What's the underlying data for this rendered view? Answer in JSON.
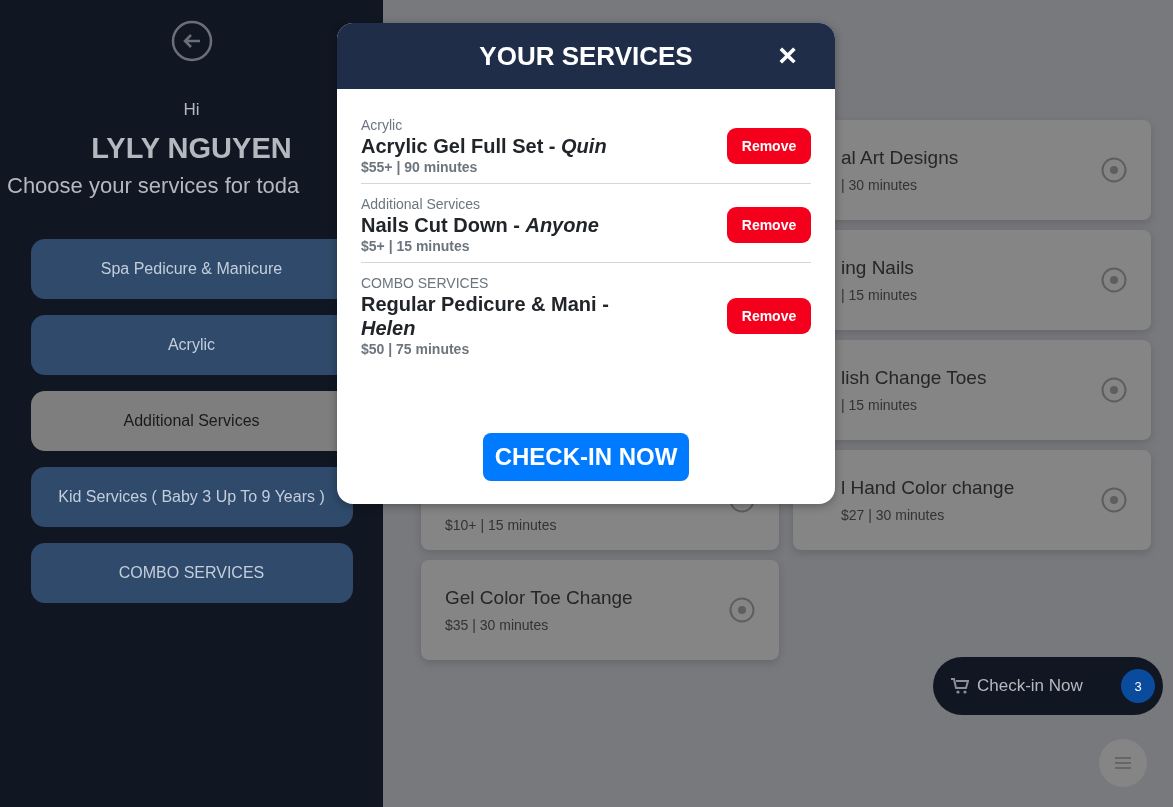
{
  "sidebar": {
    "greeting": "Hi",
    "name": "LYLY NGUYEN",
    "prompt": "Choose your services for toda",
    "categories": [
      {
        "label": "Spa Pedicure & Manicure",
        "selected": false
      },
      {
        "label": "Acrylic",
        "selected": false
      },
      {
        "label": "Additional Services",
        "selected": true
      },
      {
        "label": "Kid Services ( Baby 3 Up To 9 Years )",
        "selected": false
      },
      {
        "label": "COMBO SERVICES",
        "selected": false
      }
    ]
  },
  "service_cards_left": [
    {
      "price": "$10+ | 15 minutes"
    },
    {
      "title": "Gel Color Toe Change",
      "price": "$35 | 30 minutes"
    }
  ],
  "service_cards_right": [
    {
      "title": "al Art Designs",
      "price": "| 30 minutes"
    },
    {
      "title": "ing Nails",
      "price": "| 15 minutes"
    },
    {
      "title": "lish Change Toes",
      "price": "| 15 minutes"
    },
    {
      "title": "l Hand Color change",
      "price": "$27 | 30 minutes"
    }
  ],
  "cart_button": {
    "label": "Check-in Now",
    "count": "3"
  },
  "modal": {
    "title": "YOUR SERVICES",
    "close": "×",
    "items": [
      {
        "category": "Acrylic",
        "title": "Acrylic Gel Full Set - *Quin*",
        "details": "$55+ | 90 minutes",
        "action": "Remove"
      },
      {
        "category": "Additional Services",
        "title": "Nails Cut Down - *Anyone*",
        "details": "$5+ | 15 minutes",
        "action": "Remove"
      },
      {
        "category": "COMBO SERVICES",
        "title": "Regular Pedicure & Mani - *Helen*",
        "details": "$50 | 75 minutes",
        "action": "Remove"
      }
    ],
    "submit": "CHECK-IN NOW"
  }
}
